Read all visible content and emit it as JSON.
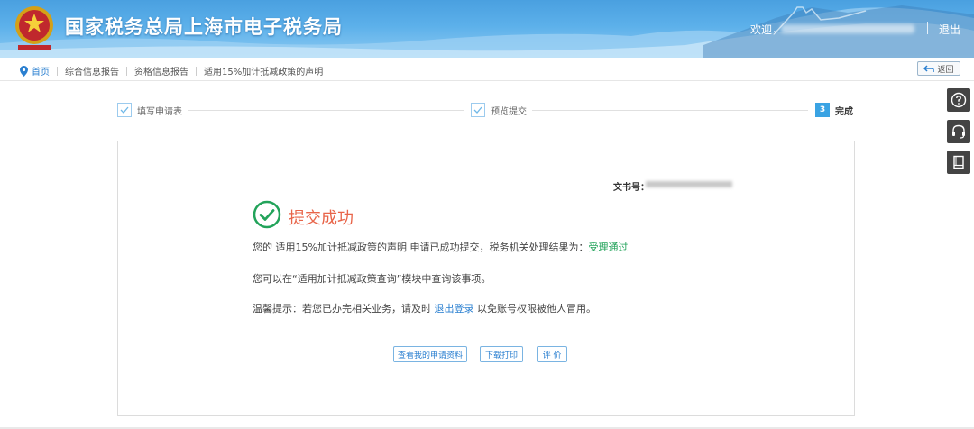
{
  "header": {
    "title": "国家税务总局上海市电子税务局",
    "welcome": "欢迎，",
    "logout": "退出"
  },
  "breadcrumb": {
    "home": "首页",
    "items": [
      "综合信息报告",
      "资格信息报告",
      "适用15%加计抵减政策的声明"
    ],
    "back": "返回"
  },
  "steps": [
    {
      "label": "填写申请表",
      "state": "done"
    },
    {
      "label": "预览提交",
      "state": "done"
    },
    {
      "number": "3",
      "label": "完成",
      "state": "current"
    }
  ],
  "result": {
    "doc_no_label": "文书号：",
    "status_title": "提交成功",
    "line1_prefix": "您的 适用15%加计抵减政策的声明 申请已成功提交，税务机关处理结果为：",
    "line1_status": "受理通过",
    "line2": "您可以在“适用加计抵减政策查询”模块中查询该事项。",
    "line3_prefix": "温馨提示：若您已办完相关业务，请及时",
    "line3_link": "退出登录",
    "line3_suffix": "以免账号权限被他人冒用。"
  },
  "actions": {
    "view_materials": "查看我的申请资料",
    "download_print": "下载打印",
    "evaluate": "评 价"
  },
  "colors": {
    "header_blue": "#4aa0e0",
    "success_green": "#22a35a",
    "title_red": "#e8654a",
    "link_blue": "#2a7fd0"
  }
}
